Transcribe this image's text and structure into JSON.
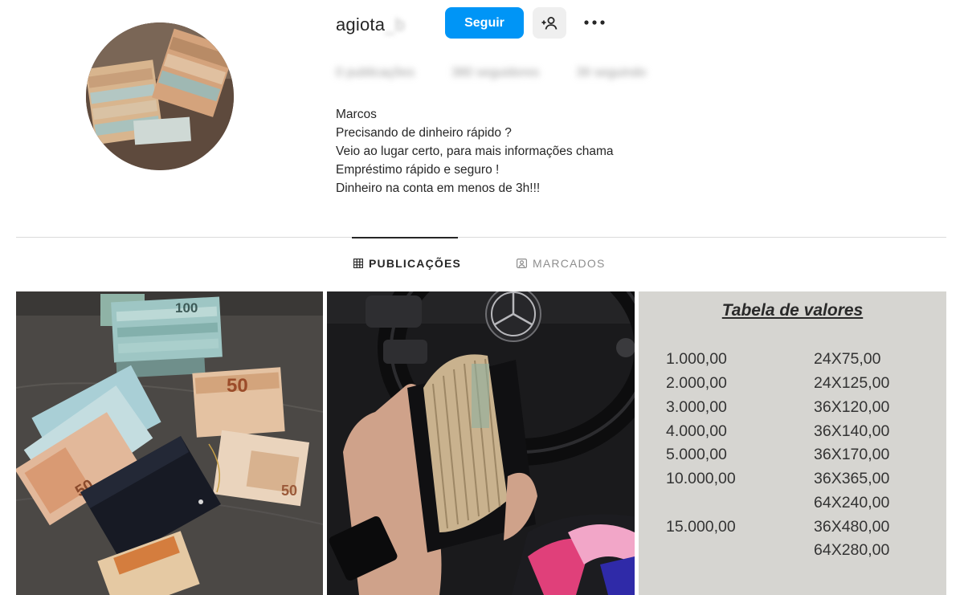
{
  "profile": {
    "username": "agiota",
    "username_hidden": "_b",
    "follow_label": "Seguir",
    "stats": [
      "0 publicações",
      "380 seguidores",
      "39 seguindo"
    ],
    "bio": [
      "Marcos",
      "Precisando de dinheiro rápido ?",
      "Veio ao lugar certo, para mais informações chama",
      "Empréstimo rápido e seguro !",
      "Dinheiro na conta em menos de 3h!!!"
    ]
  },
  "tabs": {
    "posts": "PUBLICAÇÕES",
    "tagged": "MARCADOS"
  },
  "rate_table": {
    "title": "Tabela de valores",
    "rows": [
      {
        "amount": "1.000,00",
        "value": "24X75,00"
      },
      {
        "amount": "2.000,00",
        "value": "24X125,00"
      },
      {
        "amount": "3.000,00",
        "value": "36X120,00"
      },
      {
        "amount": "4.000,00",
        "value": "36X140,00"
      },
      {
        "amount": "5.000,00",
        "value": "36X170,00"
      },
      {
        "amount": "10.000,00",
        "value": "36X365,00"
      },
      {
        "amount": "",
        "value": "64X240,00"
      },
      {
        "amount": "15.000,00",
        "value": "36X480,00"
      },
      {
        "amount": "",
        "value": "64X280,00"
      }
    ]
  },
  "banknote_labels": {
    "hundred": "100",
    "fifty": "50",
    "fifty_side": "50",
    "fifty_bottom": "50"
  },
  "colors": {
    "follow_button": "#0095f6",
    "tab_active": "#262626",
    "tab_inactive": "#8e8e8e"
  }
}
